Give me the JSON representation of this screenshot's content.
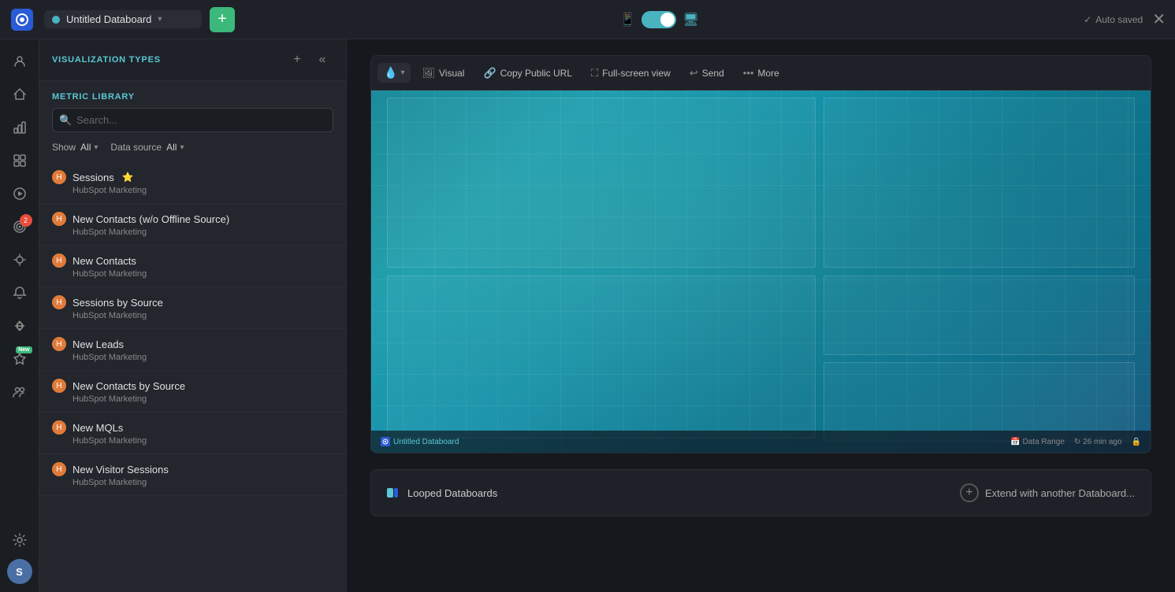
{
  "topbar": {
    "title": "Untitled Databoard",
    "add_label": "+",
    "auto_saved": "Auto saved",
    "close_icon": "✕"
  },
  "viz_panel": {
    "header_label": "VISUALIZATION TYPES",
    "metric_library_label": "METRIC LIBRARY",
    "search_placeholder": "Search...",
    "show_label": "Show",
    "show_value": "All",
    "datasource_label": "Data source",
    "datasource_value": "All"
  },
  "metrics": [
    {
      "name": "Sessions",
      "star": true,
      "source": "HubSpot Marketing"
    },
    {
      "name": "New Contacts (w/o Offline Source)",
      "star": false,
      "source": "HubSpot Marketing"
    },
    {
      "name": "New Contacts",
      "star": false,
      "source": "HubSpot Marketing"
    },
    {
      "name": "Sessions by Source",
      "star": false,
      "source": "HubSpot Marketing"
    },
    {
      "name": "New Leads",
      "star": false,
      "source": "HubSpot Marketing"
    },
    {
      "name": "New Contacts by Source",
      "star": false,
      "source": "HubSpot Marketing"
    },
    {
      "name": "New MQLs",
      "star": false,
      "source": "HubSpot Marketing"
    },
    {
      "name": "New Visitor Sessions",
      "star": false,
      "source": "HubSpot Marketing"
    }
  ],
  "toolbar": {
    "dropdown_icon": "💧",
    "visual_label": "Visual",
    "copy_url_label": "Copy Public URL",
    "fullscreen_label": "Full-screen view",
    "send_label": "Send",
    "more_label": "More"
  },
  "preview": {
    "board_name": "Untitled Databoard",
    "data_range": "Data Range",
    "refresh_time": "26 min ago"
  },
  "looped": {
    "label": "Looped Databoards",
    "extend_label": "Extend with another Databoard..."
  },
  "nav": {
    "badge_count": "2",
    "new_badge": "New",
    "avatar_initial": "S",
    "settings_icon": "⚙"
  }
}
